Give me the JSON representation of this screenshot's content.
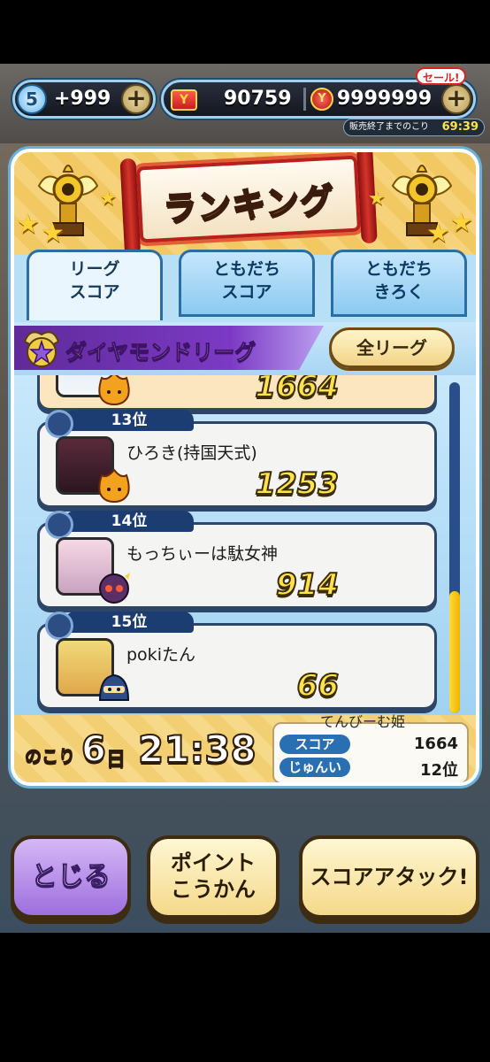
{
  "topbar": {
    "spirit_count": "5",
    "spirit_value": "+999",
    "ycoin_value": "90759",
    "ymoney_value": "9999999",
    "sale_label": "セール!",
    "sale_timer_label": "販売終了までのこり",
    "sale_timer_value": "69:39"
  },
  "panel": {
    "title": "ランキング",
    "tabs": [
      {
        "line1": "リーグ",
        "line2": "スコア"
      },
      {
        "line1": "ともだち",
        "line2": "スコア"
      },
      {
        "line1": "ともだち",
        "line2": "きろく"
      }
    ],
    "league_name": "ダイヤモンドリーグ",
    "all_league_button": "全リーグ"
  },
  "rankings": [
    {
      "rank": "",
      "name": "",
      "score": "1664"
    },
    {
      "rank": "13位",
      "name": "ひろき(持国天式)",
      "score": "1253"
    },
    {
      "rank": "14位",
      "name": "もっちぃーは駄女神",
      "score": "914"
    },
    {
      "rank": "15位",
      "name": "pokiたん",
      "score": "66"
    }
  ],
  "footer": {
    "remain_label": "のこり",
    "remain_days": "6",
    "remain_unit": "日",
    "remain_time": "21:38",
    "player_name": "てんびーむ姫",
    "score_label": "スコア",
    "score_value": "1664",
    "rank_label": "じゅんい",
    "rank_value": "12位"
  },
  "buttons": {
    "close": "とじる",
    "points_line1": "ポイント",
    "points_line2": "こうかん",
    "score_attack": "スコアアタック!"
  }
}
